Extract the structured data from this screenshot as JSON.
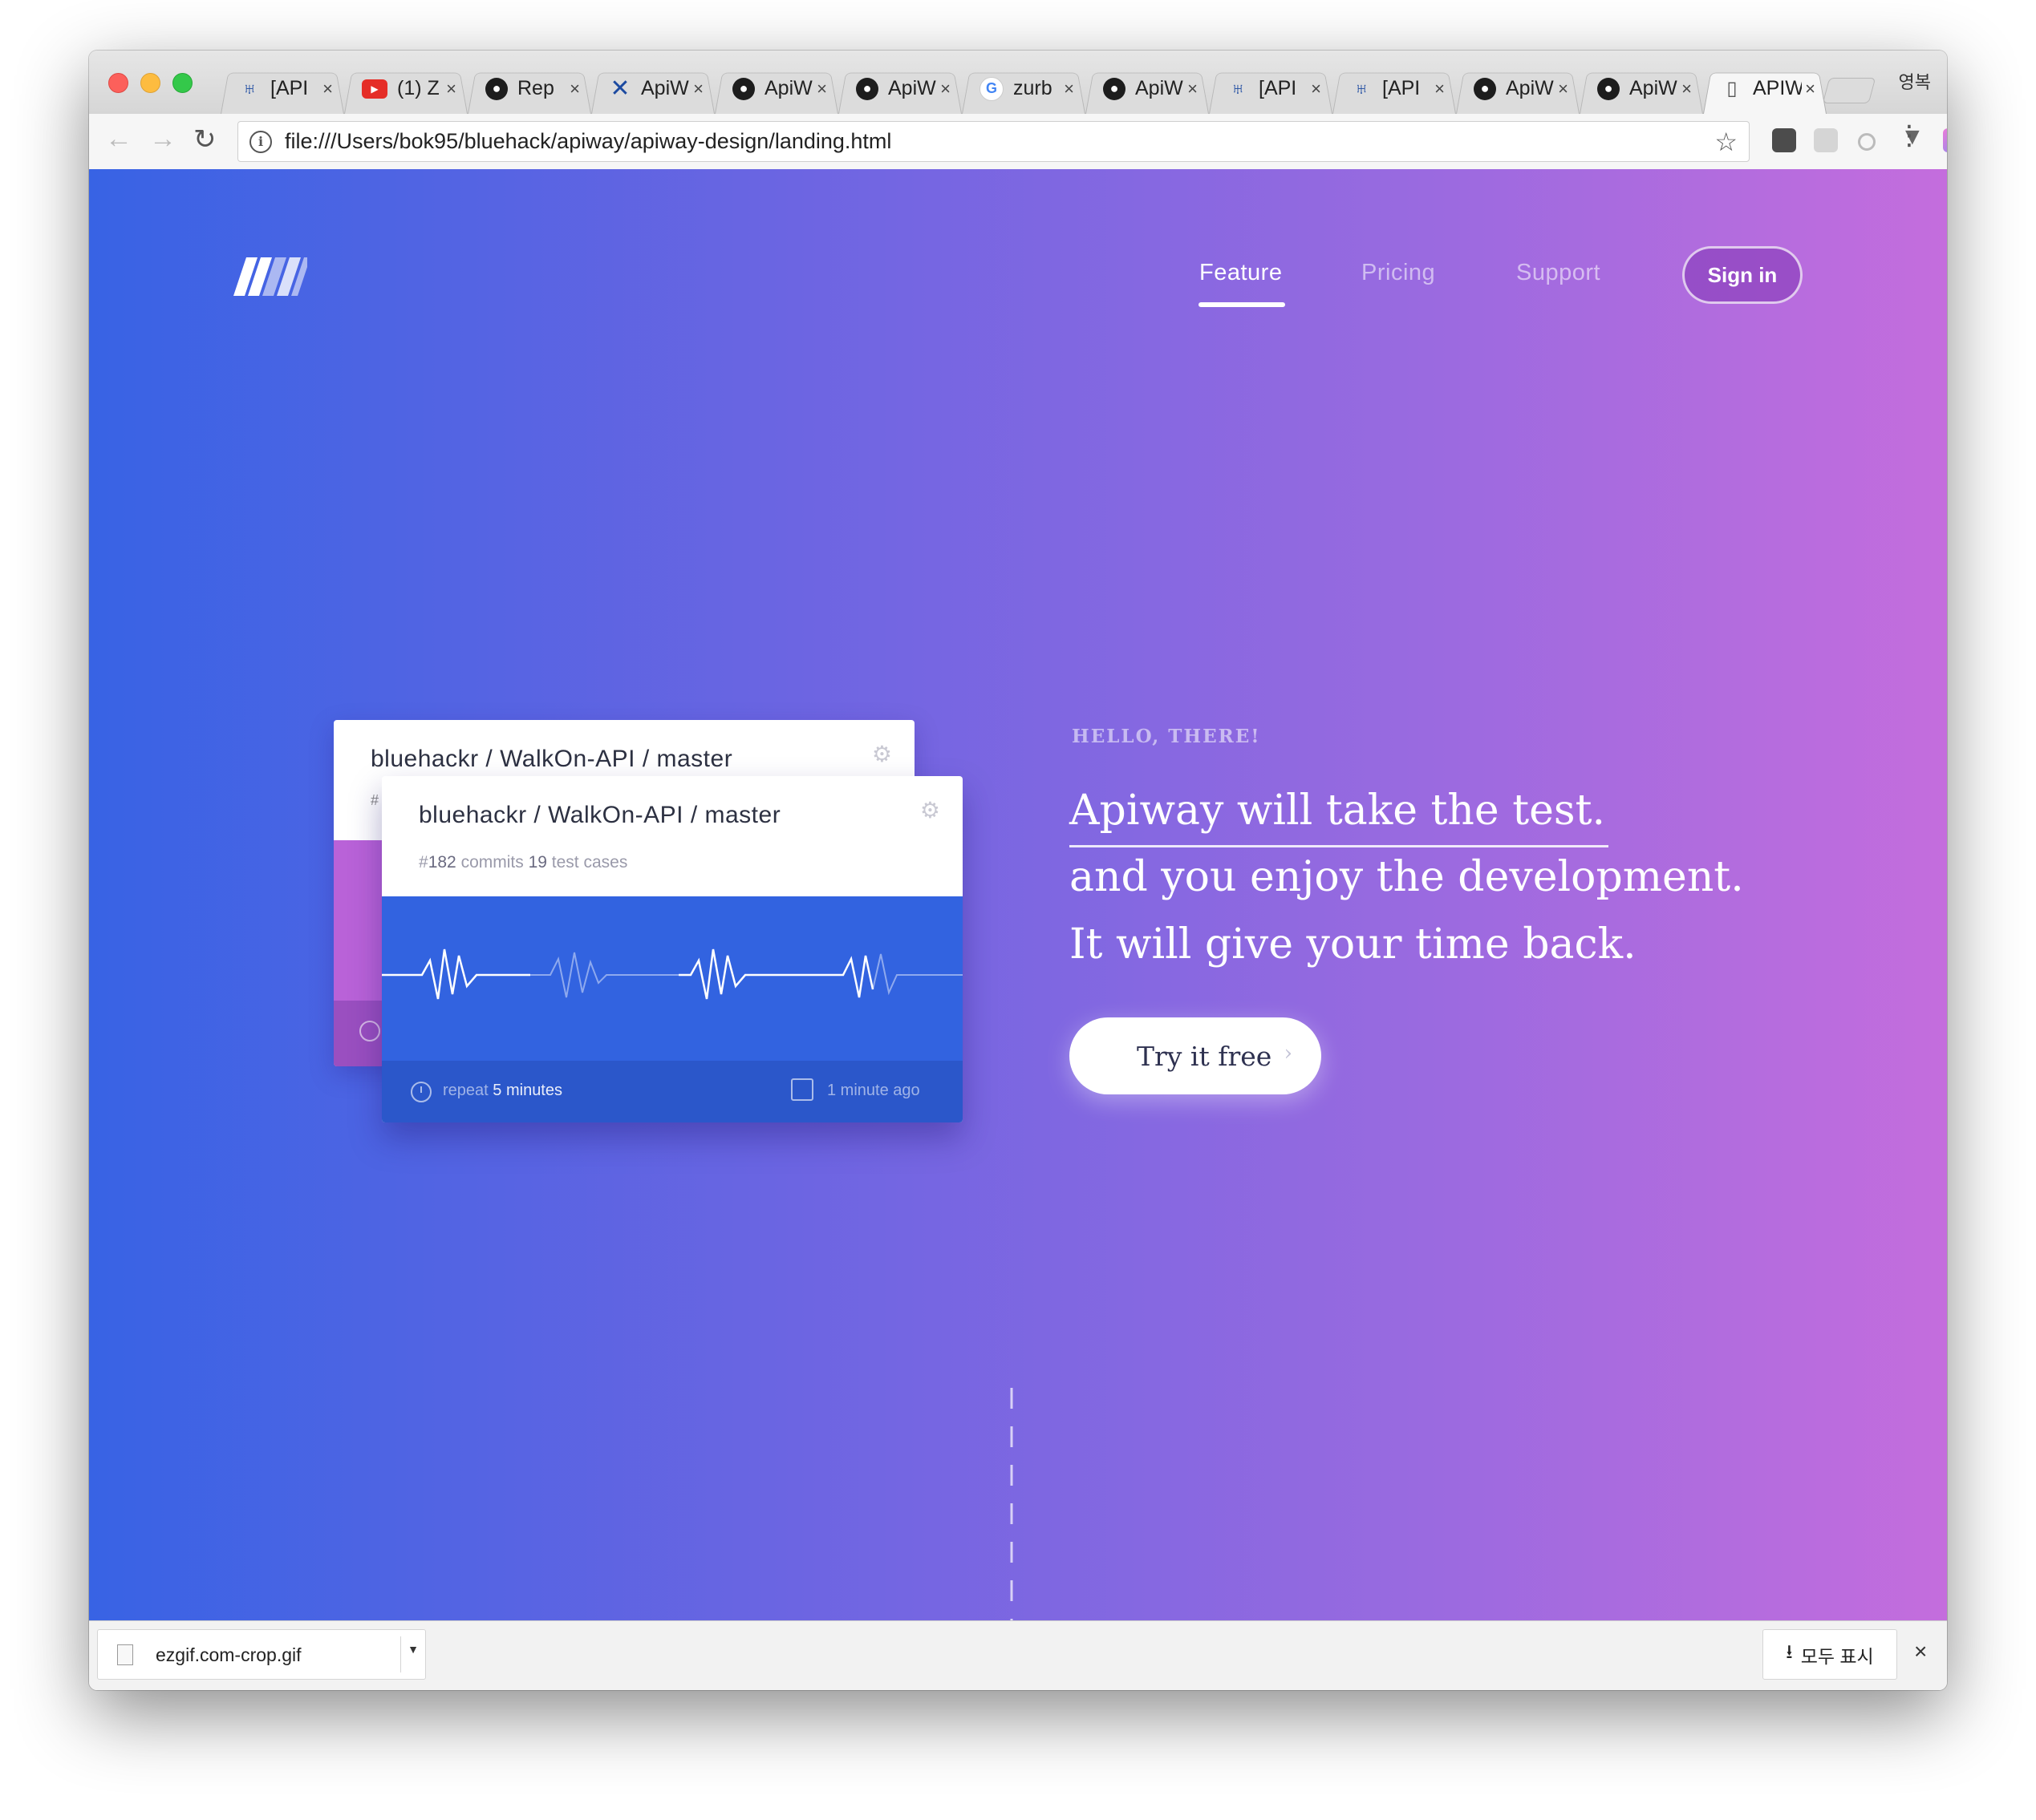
{
  "browser": {
    "tabs": [
      {
        "icon": "jira-icon",
        "title": "[API"
      },
      {
        "icon": "youtube-icon",
        "title": "(1) Z"
      },
      {
        "icon": "github-icon",
        "title": "Rep"
      },
      {
        "icon": "apiway-x-icon",
        "title": "ApiW"
      },
      {
        "icon": "github-icon",
        "title": "ApiW"
      },
      {
        "icon": "github-icon",
        "title": "ApiW"
      },
      {
        "icon": "google-icon",
        "title": "zurb"
      },
      {
        "icon": "github-icon",
        "title": "ApiW"
      },
      {
        "icon": "jira-icon",
        "title": "[API"
      },
      {
        "icon": "jira-icon",
        "title": "[API"
      },
      {
        "icon": "github-icon",
        "title": "ApiW"
      },
      {
        "icon": "github-icon",
        "title": "ApiW"
      },
      {
        "icon": "document-icon",
        "title": "APIW",
        "active": true
      }
    ],
    "tab_close": "×",
    "profile_label": "영복",
    "url": "file:///Users/bok95/bluehack/apiway/apiway-design/landing.html"
  },
  "nav": {
    "links": [
      "Feature",
      "Pricing",
      "Support"
    ],
    "active": "Feature",
    "signin_label": "Sign in"
  },
  "cards": {
    "back": {
      "title": "bluehackr / WalkOn-API / master",
      "hash": "#"
    },
    "front": {
      "title": "bluehackr / WalkOn-API / master",
      "commit_prefix": "#",
      "commit_number": "182",
      "commits_label": "commits",
      "test_cases_count": "19",
      "test_cases_label": "test cases",
      "repeat_label": "repeat",
      "repeat_value": "5 minutes",
      "last_run": "1 minute ago"
    }
  },
  "hero": {
    "eyebrow": "HELLO, THERE!",
    "lines": [
      "Apiway will take the test.",
      "and you enjoy the development.",
      "It will give your time back."
    ],
    "cta_label": "Try it free"
  },
  "downloads": {
    "file_name": "ezgif.com-crop.gif",
    "show_all_label": "모두 표시",
    "close": "×"
  },
  "colors": {
    "gradient_start": "#3863e4",
    "gradient_end": "#c46ddd",
    "card_graph": "#3263e0",
    "card_footer": "#2b57ca",
    "back_card_accent": "#b962d8"
  }
}
